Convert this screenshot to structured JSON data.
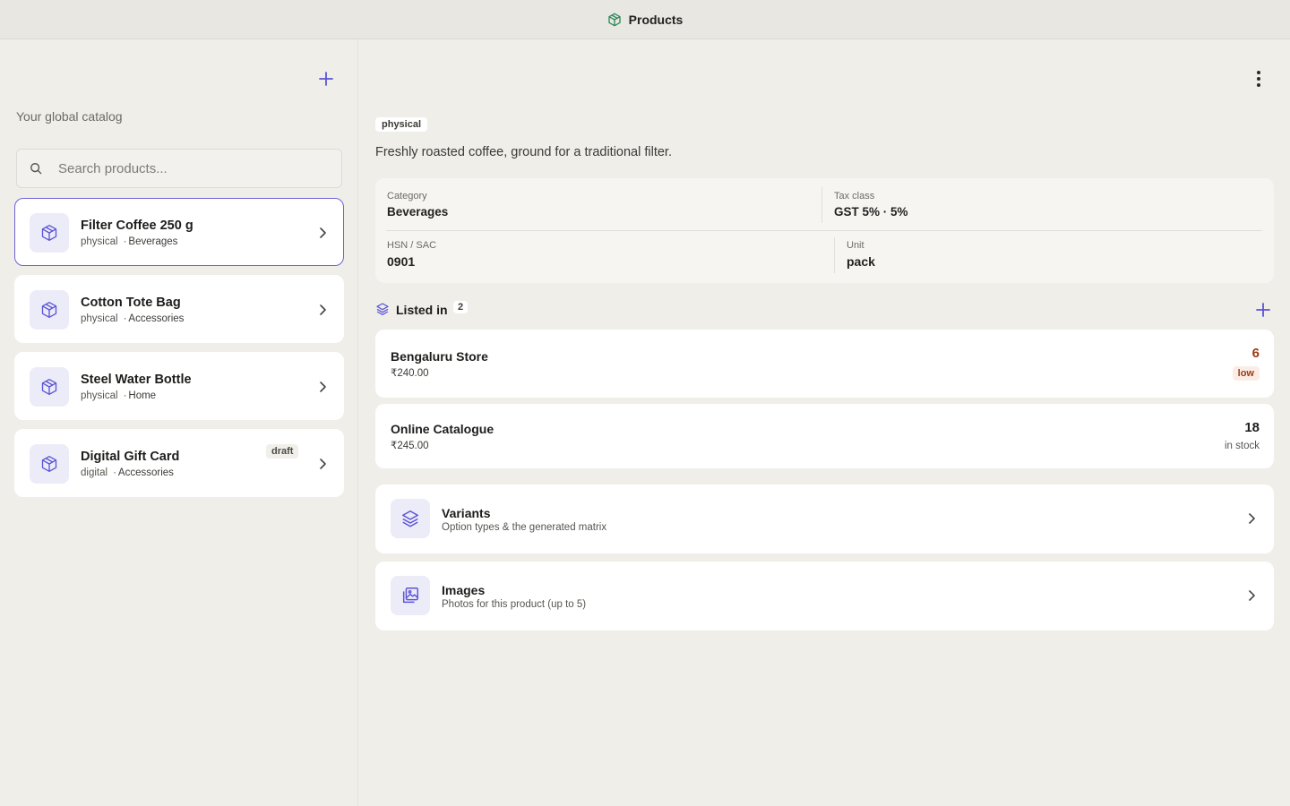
{
  "topbar": {
    "title": "Products",
    "icon": "box-icon",
    "accent": "#2d8a5a"
  },
  "sidebar": {
    "subtitle": "Your global catalog",
    "search_placeholder": "Search products...",
    "products": [
      {
        "name": "Filter Coffee 250 g",
        "type": "physical",
        "category": "Beverages",
        "badge": "",
        "selected": true
      },
      {
        "name": "Cotton Tote Bag",
        "type": "physical",
        "category": "Accessories",
        "badge": "",
        "selected": false
      },
      {
        "name": "Steel Water Bottle",
        "type": "physical",
        "category": "Home",
        "badge": "",
        "selected": false
      },
      {
        "name": "Digital Gift Card",
        "type": "digital",
        "category": "Accessories",
        "badge": "draft",
        "selected": false
      }
    ]
  },
  "detail": {
    "type_badge": "physical",
    "description": "Freshly roasted coffee, ground for a traditional filter.",
    "attributes": {
      "category_label": "Category",
      "category_value": "Beverages",
      "tax_label": "Tax class",
      "tax_value": "GST 5% · 5%",
      "hsn_label": "HSN / SAC",
      "hsn_value": "0901",
      "unit_label": "Unit",
      "unit_value": "pack"
    },
    "listed_in": {
      "title": "Listed in",
      "count": "2",
      "stores": [
        {
          "name": "Bengaluru Store",
          "price": "₹240.00",
          "qty": "6",
          "status": "low"
        },
        {
          "name": "Online Catalogue",
          "price": "₹245.00",
          "qty": "18",
          "status": "in stock"
        }
      ]
    },
    "sections": [
      {
        "title": "Variants",
        "subtitle": "Option types & the generated matrix",
        "icon": "layers-icon"
      },
      {
        "title": "Images",
        "subtitle": "Photos for this product (up to 5)",
        "icon": "images-icon"
      }
    ]
  },
  "colors": {
    "accent": "#5b54d6",
    "background": "#f0eee9",
    "card": "#ffffff",
    "low_stock": "#9a3a14"
  }
}
